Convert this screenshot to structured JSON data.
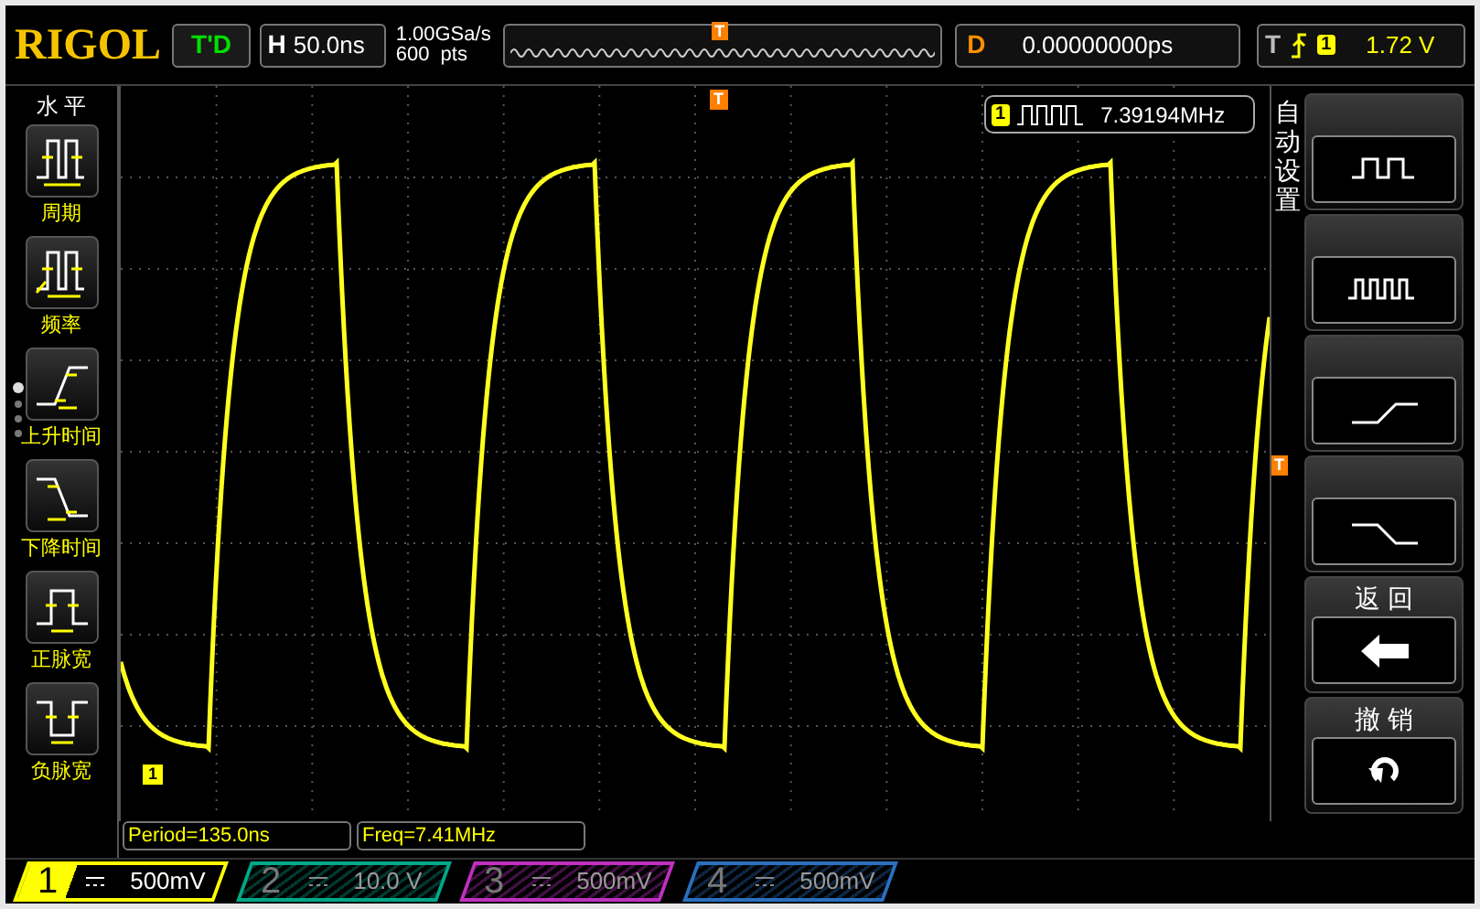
{
  "brand": "RIGOL",
  "run_status": "T'D",
  "timebase": {
    "label": "H",
    "value": "50.0ns"
  },
  "sample_rate": "1.00GSa/s",
  "memory_depth": "600  pts",
  "overview_trigger": "T",
  "delay": {
    "label": "D",
    "value": "0.00000000ps"
  },
  "trigger": {
    "label": "T",
    "channel": "1",
    "level": "1.72 V"
  },
  "menu_title": "水 平",
  "measure_items": [
    {
      "label": "周期",
      "kind": "period"
    },
    {
      "label": "频率",
      "kind": "frequency"
    },
    {
      "label": "上升时间",
      "kind": "rise"
    },
    {
      "label": "下降时间",
      "kind": "fall"
    },
    {
      "label": "正脉宽",
      "kind": "pos-width"
    },
    {
      "label": "负脉宽",
      "kind": "neg-width"
    }
  ],
  "pages": [
    {
      "selected": true
    },
    {
      "selected": false
    },
    {
      "selected": false
    },
    {
      "selected": false
    }
  ],
  "frequency_badge": {
    "channel": "1",
    "value": "7.39194MHz"
  },
  "markers": {
    "trigger_time": "T",
    "trigger_level": "T",
    "channel": "1"
  },
  "auto_set": {
    "title": "自动设置",
    "buttons": [
      {
        "kind": "single-period"
      },
      {
        "kind": "multi-period"
      },
      {
        "kind": "rise"
      },
      {
        "kind": "fall"
      }
    ]
  },
  "back": {
    "title": "返 回"
  },
  "undo": {
    "title": "撤 销"
  },
  "measurements": [
    "Period=135.0ns",
    "Freq=7.41MHz"
  ],
  "channels": [
    {
      "number": "1",
      "scale": "500mV",
      "active": true,
      "color": "#ffff00"
    },
    {
      "number": "2",
      "scale": "10.0 V",
      "active": false,
      "color": "#00a88a"
    },
    {
      "number": "3",
      "scale": "500mV",
      "active": false,
      "color": "#c030c0"
    },
    {
      "number": "4",
      "scale": "500mV",
      "active": false,
      "color": "#2a70c0"
    }
  ]
}
